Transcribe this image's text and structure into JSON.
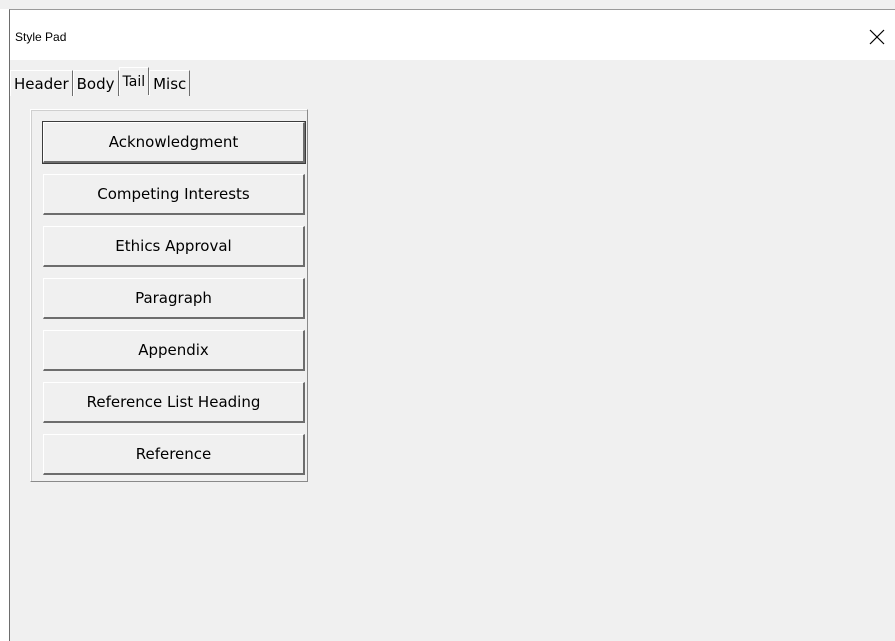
{
  "window": {
    "title": "Style Pad"
  },
  "tabs": [
    {
      "label": "Header",
      "active": false
    },
    {
      "label": "Body",
      "active": false
    },
    {
      "label": "Tail",
      "active": true
    },
    {
      "label": "Misc",
      "active": false
    }
  ],
  "buttons": [
    {
      "label": "Acknowledgment"
    },
    {
      "label": "Competing Interests"
    },
    {
      "label": "Ethics Approval"
    },
    {
      "label": "Paragraph"
    },
    {
      "label": "Appendix"
    },
    {
      "label": "Reference List Heading"
    },
    {
      "label": "Reference"
    }
  ],
  "icons": {
    "close": "close-icon"
  }
}
